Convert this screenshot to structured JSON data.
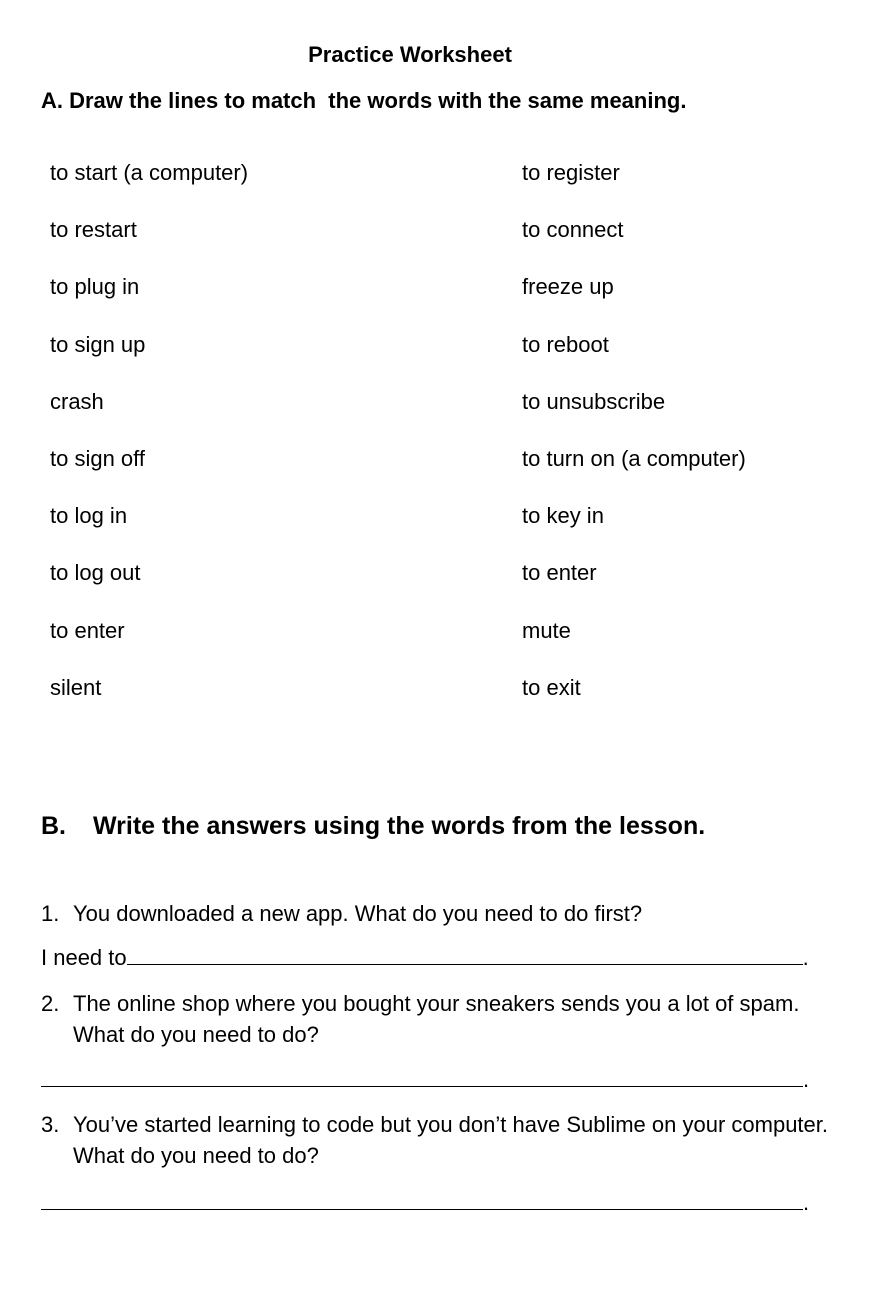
{
  "title": "Practice Worksheet",
  "section_a": {
    "heading": "A. Draw the lines to match  the words with the same meaning.",
    "left_words": [
      "to start (a computer)",
      "to restart",
      "to plug in",
      "to sign up",
      "crash",
      "to sign off",
      "to log in",
      "to log out",
      "to enter",
      "silent"
    ],
    "right_words": [
      "to register",
      "to connect",
      "freeze up",
      "to reboot",
      "to unsubscribe",
      "to turn on (a computer)",
      "to key in",
      "to enter",
      "mute",
      "to exit"
    ]
  },
  "section_b": {
    "number": "B.",
    "heading": "Write the answers using the words from the lesson.",
    "questions": [
      {
        "number": "1.",
        "text": "You downloaded a new app.  What do you need to do first?",
        "answer_prefix": "I need to",
        "answer_end": "."
      },
      {
        "number": "2.",
        "text": "The online shop where you bought your sneakers sends you a lot of spam. What do you need to do?",
        "answer_prefix": "",
        "answer_end": "."
      },
      {
        "number": "3.",
        "text": "You’ve started learning to code but you don’t have Sublime on your computer. What do you need to do?",
        "answer_prefix": "",
        "answer_end": "."
      }
    ]
  }
}
